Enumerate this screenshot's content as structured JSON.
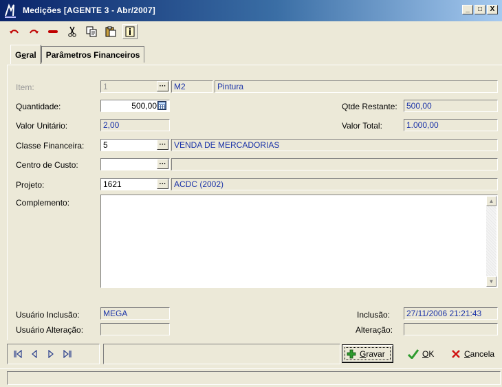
{
  "window": {
    "title": "Medições [AGENTE 3 - Abr/2007]",
    "buttons": {
      "minimize": "_",
      "maximize": "□",
      "close": "X"
    }
  },
  "toolbar": {
    "icons": [
      "undo-icon",
      "redo-icon",
      "delete-icon",
      "cut-icon",
      "copy-icon",
      "paste-icon",
      "info-icon"
    ]
  },
  "tabs": [
    {
      "pre": "G",
      "ul": "e",
      "post": "ral"
    },
    {
      "label": "Parâmetros Financeiros"
    }
  ],
  "form": {
    "item": {
      "label": "Item:",
      "code": "1",
      "unit": "M2",
      "description": "Pintura"
    },
    "quantidade": {
      "label": "Quantidade:",
      "value": "500,00"
    },
    "qtde_restante": {
      "label": "Qtde Restante:",
      "value": "500,00"
    },
    "valor_unitario": {
      "label": "Valor Unitário:",
      "value": "2,00"
    },
    "valor_total": {
      "label": "Valor Total:",
      "value": "1.000,00"
    },
    "classe_financeira": {
      "label": "Classe Financeira:",
      "code": "5",
      "description": "VENDA DE MERCADORIAS"
    },
    "centro_custo": {
      "label": "Centro de Custo:",
      "code": "",
      "description": ""
    },
    "projeto": {
      "label": "Projeto:",
      "code": "1621",
      "description": "ACDC (2002)"
    },
    "complemento": {
      "label": "Complemento:",
      "value": ""
    },
    "usuario_inclusao": {
      "label": "Usuário Inclusão:",
      "value": "MEGA"
    },
    "usuario_alteracao": {
      "label": "Usuário Alteração:",
      "value": ""
    },
    "inclusao": {
      "label": "Inclusão:",
      "value": "27/11/2006 21:21:43"
    },
    "alteracao": {
      "label": "Alteração:",
      "value": ""
    }
  },
  "actions": {
    "gravar": {
      "ul": "G",
      "rest": "ravar"
    },
    "ok": {
      "ul": "O",
      "rest": "K"
    },
    "cancela": {
      "ul": "C",
      "rest": "ancela"
    }
  },
  "colors": {
    "readonly_text": "#1c34a8",
    "titlebar": "#0a246a"
  }
}
